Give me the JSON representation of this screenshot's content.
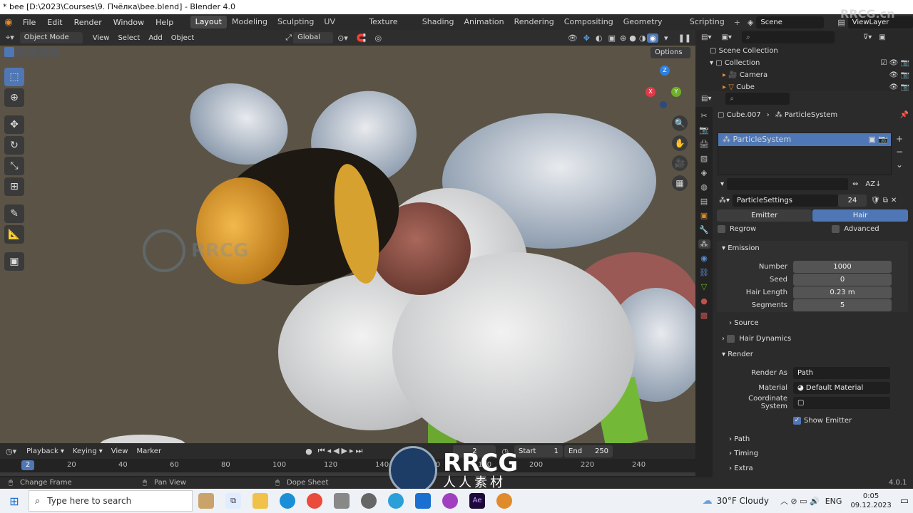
{
  "window": {
    "title": "* bee [D:\\2023\\Courses\\9. Пчёлка\\bee.blend] - Blender 4.0"
  },
  "menu": [
    "File",
    "Edit",
    "Render",
    "Window",
    "Help"
  ],
  "workspaces": [
    {
      "label": "Layout",
      "active": true
    },
    {
      "label": "Modeling"
    },
    {
      "label": "Sculpting"
    },
    {
      "label": "UV Editing"
    },
    {
      "label": "Texture Paint"
    },
    {
      "label": "Shading"
    },
    {
      "label": "Animation"
    },
    {
      "label": "Rendering"
    },
    {
      "label": "Compositing"
    },
    {
      "label": "Geometry Nodes"
    },
    {
      "label": "Scripting"
    }
  ],
  "scene": {
    "scene_name": "Scene",
    "view_layer": "ViewLayer"
  },
  "viewport_header": {
    "mode": "Object Mode",
    "menus": [
      "View",
      "Select",
      "Add",
      "Object"
    ],
    "orientation": "Global",
    "options": "Options"
  },
  "gizmo": {
    "x": "X",
    "y": "Y",
    "z": "Z"
  },
  "outliner": {
    "items": [
      {
        "label": "Scene Collection"
      },
      {
        "label": "Collection"
      },
      {
        "label": "Camera"
      },
      {
        "label": "Cube"
      }
    ]
  },
  "properties": {
    "object": "Cube.007",
    "psys": "ParticleSystem",
    "list_item": "ParticleSystem",
    "settings_name": "ParticleSettings",
    "users": "24",
    "type_emitter": "Emitter",
    "type_hair": "Hair",
    "regrow": "Regrow",
    "advanced": "Advanced",
    "emission": {
      "title": "Emission",
      "number_label": "Number",
      "number": "1000",
      "seed_label": "Seed",
      "seed": "0",
      "hair_length_label": "Hair Length",
      "hair_length": "0.23 m",
      "segments_label": "Segments",
      "segments": "5"
    },
    "source": "Source",
    "hair_dynamics": "Hair Dynamics",
    "render": {
      "title": "Render",
      "render_as_label": "Render As",
      "render_as": "Path",
      "material_label": "Material",
      "material": "Default Material",
      "coord_label": "Coordinate System",
      "show_emitter": "Show Emitter"
    },
    "path": "Path",
    "timing": "Timing",
    "extra": "Extra"
  },
  "timeline": {
    "menus": [
      "Playback",
      "Keying",
      "View",
      "Marker"
    ],
    "current_frame": "2",
    "start_label": "Start",
    "start": "1",
    "end_label": "End",
    "end": "250",
    "ticks": [
      "20",
      "40",
      "60",
      "80",
      "100",
      "120",
      "140",
      "160",
      "180",
      "200",
      "220",
      "240"
    ],
    "current_badge": "2"
  },
  "statusbar": {
    "change_frame": "Change Frame",
    "pan_view": "Pan View",
    "dope_sheet": "Dope Sheet",
    "version": "4.0.1"
  },
  "watermark": {
    "brand": "RRCG",
    "sub": "人人素材",
    "corner": "RRCG.cn"
  },
  "taskbar": {
    "search_placeholder": "Type here to search",
    "weather": "30°F  Cloudy",
    "lang": "ENG",
    "time": "0:05",
    "date": "09.12.2023"
  },
  "colors": {
    "accent": "#4f77b5",
    "viewport_bg": "#5b5446"
  }
}
